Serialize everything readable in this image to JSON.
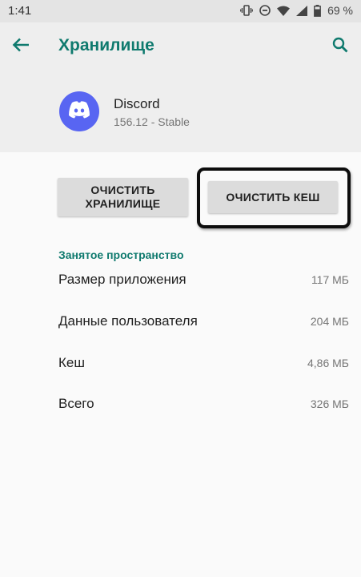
{
  "status_bar": {
    "time": "1:41",
    "battery": "69 %",
    "icons": [
      "vibrate-icon",
      "do-not-disturb-icon",
      "wifi-icon",
      "signal-icon",
      "battery-icon"
    ]
  },
  "header": {
    "title": "Хранилище",
    "back_icon": "arrow-back-icon",
    "search_icon": "search-icon"
  },
  "app": {
    "name": "Discord",
    "version": "156.12 - Stable",
    "icon_color": "#5865f2"
  },
  "buttons": {
    "clear_storage_line1": "ОЧИСТИТЬ",
    "clear_storage_line2": "ХРАНИЛИЩЕ",
    "clear_cache": "ОЧИСТИТЬ КЕШ"
  },
  "section": {
    "title": "Занятое пространство"
  },
  "rows": [
    {
      "label": "Размер приложения",
      "value": "117 МБ"
    },
    {
      "label": "Данные пользователя",
      "value": "204 МБ"
    },
    {
      "label": "Кеш",
      "value": "4,86 МБ"
    },
    {
      "label": "Всего",
      "value": "326 МБ"
    }
  ],
  "colors": {
    "accent": "#0f7a6e",
    "header_bg": "#eeeeee",
    "button_bg": "#dcdcdc"
  }
}
